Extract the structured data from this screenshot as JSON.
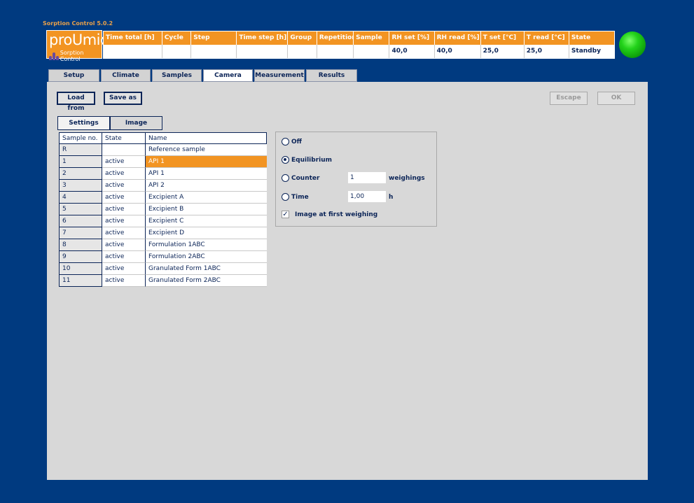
{
  "app_title": "Sorption Control 5.0.2",
  "logo": {
    "name": "proUmid",
    "subtitle": "Sorption Control"
  },
  "status": {
    "headers": [
      "Time total [h]",
      "Cycle",
      "Step",
      "Time step [h]",
      "Group",
      "Repetition",
      "Sample",
      "RH set [%]",
      "RH read [%]",
      "T set [°C]",
      "T read [°C]",
      "State"
    ],
    "values": [
      "",
      "",
      "",
      "",
      "",
      "",
      "",
      "40,0",
      "40,0",
      "25,0",
      "25,0",
      "Standby"
    ],
    "led_color": "#22d21a"
  },
  "tabs": [
    "Setup",
    "Climate",
    "Samples",
    "Camera",
    "Measurement",
    "Results"
  ],
  "active_tab": "Camera",
  "buttons": {
    "load": "Load from",
    "save": "Save as",
    "escape": "Escape",
    "ok": "OK"
  },
  "subtabs": [
    "Settings",
    "Image"
  ],
  "samples": {
    "headers": [
      "Sample no.",
      "State",
      "Name"
    ],
    "rows": [
      {
        "no": "R",
        "state": "",
        "name": "Reference sample"
      },
      {
        "no": "1",
        "state": "active",
        "name": "API 1"
      },
      {
        "no": "2",
        "state": "active",
        "name": "API 1"
      },
      {
        "no": "3",
        "state": "active",
        "name": "API 2"
      },
      {
        "no": "4",
        "state": "active",
        "name": "Excipient A"
      },
      {
        "no": "5",
        "state": "active",
        "name": "Excipient B"
      },
      {
        "no": "6",
        "state": "active",
        "name": "Excipient C"
      },
      {
        "no": "7",
        "state": "active",
        "name": "Excipient D"
      },
      {
        "no": "8",
        "state": "active",
        "name": "Formulation 1ABC"
      },
      {
        "no": "9",
        "state": "active",
        "name": "Formulation 2ABC"
      },
      {
        "no": "10",
        "state": "active",
        "name": "Granulated Form 1ABC"
      },
      {
        "no": "11",
        "state": "active",
        "name": "Granulated Form 2ABC"
      }
    ],
    "selected_index": 1
  },
  "options": {
    "off": "Off",
    "equilibrium": "Equilibrium",
    "counter": "Counter",
    "counter_value": "1",
    "counter_unit": "weighings",
    "time": "Time",
    "time_value": "1,00",
    "time_unit": "h",
    "first_weighing": "Image at first weighing",
    "selected": "equilibrium",
    "first_weighing_checked": true
  },
  "colors": {
    "background": "#003a80",
    "accent": "#f29422",
    "panel": "#d8d8d8",
    "text": "#0b2457"
  }
}
